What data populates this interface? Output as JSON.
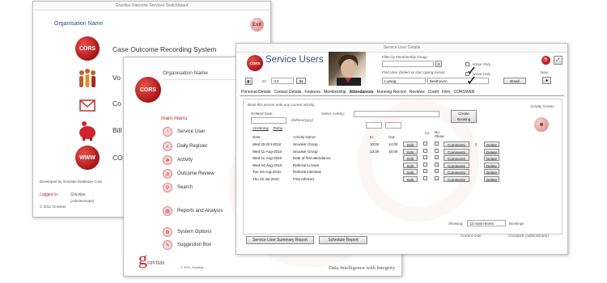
{
  "switchboard": {
    "title": "Gravitas Outcome Services Switchboard",
    "org_label": "Organisation Name",
    "exit_label": "Exit",
    "items": [
      {
        "icon": "cors-logo",
        "label": "Case Outcome Recording System",
        "icon_text": "CORS"
      },
      {
        "icon": "people-icon",
        "label": "Vo"
      },
      {
        "icon": "mail-icon",
        "label": "Co"
      },
      {
        "icon": "piggybank-icon",
        "label": "Bill"
      },
      {
        "icon": "www-icon",
        "label": "CO",
        "icon_text": "WWW"
      }
    ],
    "devby": "Developed by Gravitas Database Corp",
    "logged_in_label": "Logged in:",
    "logged_in_user": "Gravitas",
    "logged_in_role": "(Administrator)",
    "copyright": "© 2011 Gravitas"
  },
  "mainmenu": {
    "org_label": "Organisation Name",
    "logo_text": "CORS",
    "heading": "main menu",
    "items": [
      {
        "icon": "arrow-up-icon",
        "glyph": "↑",
        "label": "Service User"
      },
      {
        "icon": "check-icon",
        "glyph": "✓",
        "label": "Daily Register"
      },
      {
        "icon": "activity-icon",
        "glyph": "❄",
        "label": "Activity"
      },
      {
        "icon": "target-icon",
        "glyph": "◎",
        "label": "Outcome Review"
      },
      {
        "icon": "search-icon",
        "glyph": "⚲",
        "label": "Search"
      },
      {
        "icon": "reports-icon",
        "glyph": "▤",
        "label": "Reports and Analysis"
      },
      {
        "icon": "options-icon",
        "glyph": "⚙",
        "label": "System Options"
      },
      {
        "icon": "suggestion-icon",
        "glyph": "✎",
        "label": "Suggestion Box"
      }
    ],
    "brand": "ravitas",
    "brand_g": "g",
    "copyright": "© 2011 Gravitas",
    "tagline": "Data Intelligence with Integrity"
  },
  "service_users": {
    "window_title": "Service User Details",
    "title": "Service Users",
    "logo_text": "CORS",
    "filter_label": "Filter by Membership Group:",
    "find_label": "Find User (Select or start typing name)",
    "first_name": "Ludwig",
    "last_name": "Beethoven",
    "active_only": "Active Only",
    "email_btn": "Email",
    "new_label": "New",
    "id_label": "ID:",
    "id_value": "/13",
    "id_btn": "IN",
    "tabs": [
      "Personal Details",
      "Contact Details",
      "Features",
      "Membership",
      "Attendances",
      "Running Record",
      "Reviews",
      "Credit",
      "Files",
      "CORSWEB"
    ],
    "book_heading": "Book this person onto any current activity...",
    "date_label": "Related Date:",
    "date_hint": "(dd/mm/yyyy)",
    "activity_label": "Select Activity:",
    "create_btn": "Create Booking",
    "activity_screen": "Activity Screen",
    "yesterday": "Yesterday",
    "today": "Today",
    "columns": {
      "date": "Date:",
      "activity": "Activity Name:",
      "in": "In:",
      "out": "Out:",
      "cx": "Cx",
      "noshow": "No Show:"
    },
    "rows": [
      {
        "date": "Wed 20-Oct-2010",
        "activity": "Snooker Group",
        "in": "10:00",
        "out": "14:00",
        "num": "2"
      },
      {
        "date": "Wed 11-Aug-2010",
        "activity": "Snooker Group",
        "in": "13:30",
        "out": "16:00",
        "num": ""
      },
      {
        "date": "Wed 11-Aug-2010",
        "activity": "Date of first attendance",
        "in": "",
        "out": "",
        "num": ""
      },
      {
        "date": "Wed 04-Aug-2010",
        "activity": "Referral to team",
        "in": "",
        "out": "",
        "num": ""
      },
      {
        "date": "Tue 03-Aug-2010",
        "activity": "Referral interview",
        "in": "",
        "out": "",
        "num": ""
      },
      {
        "date": "Thu 22-Jul-2010",
        "activity": "First referred",
        "in": "",
        "out": "",
        "num": ""
      }
    ],
    "edit_btn": "Edit",
    "comments_btn": "Comments",
    "delete_btn": "Delete",
    "showing_label": "Showing:",
    "showing_value": "12 most recent",
    "bookings_label": "Bookings",
    "summary_btn": "Service User Summary Report",
    "schedule_btn": "Schedule Report",
    "current_user_label": "Current User:",
    "current_user": "Gravitash (Administrator)"
  }
}
